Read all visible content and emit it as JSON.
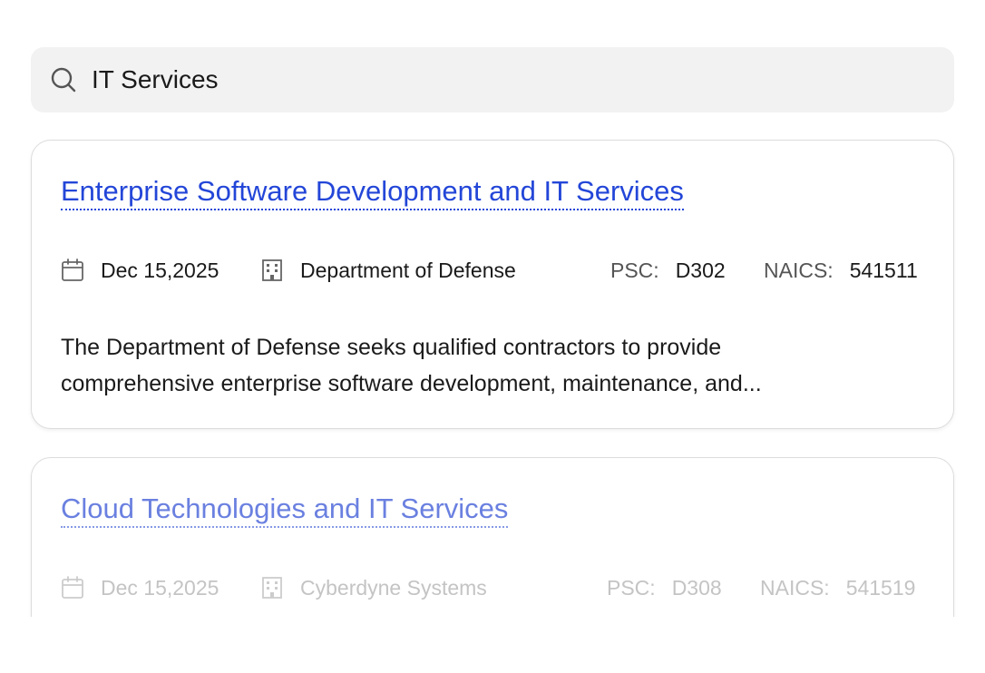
{
  "search": {
    "value": "IT Services"
  },
  "results": [
    {
      "title": "Enterprise Software Development and IT Services",
      "date": "Dec 15,2025",
      "agency": "Department of Defense",
      "psc_label": "PSC:",
      "psc_value": "D302",
      "naics_label": "NAICS:",
      "naics_value": "541511",
      "description_line1": "The Department of Defense seeks qualified contractors to provide",
      "description_line2": "comprehensive enterprise software development, maintenance, and..."
    },
    {
      "title": "Cloud Technologies and IT Services",
      "date": "Dec 15,2025",
      "agency": "Cyberdyne Systems",
      "psc_label": "PSC:",
      "psc_value": "D308",
      "naics_label": "NAICS:",
      "naics_value": "541519"
    }
  ],
  "icons": {
    "search": "search-icon",
    "date": "calendar-icon",
    "agency": "building-icon"
  },
  "colors": {
    "link": "#2346d8",
    "search_bg": "#f2f2f2"
  }
}
